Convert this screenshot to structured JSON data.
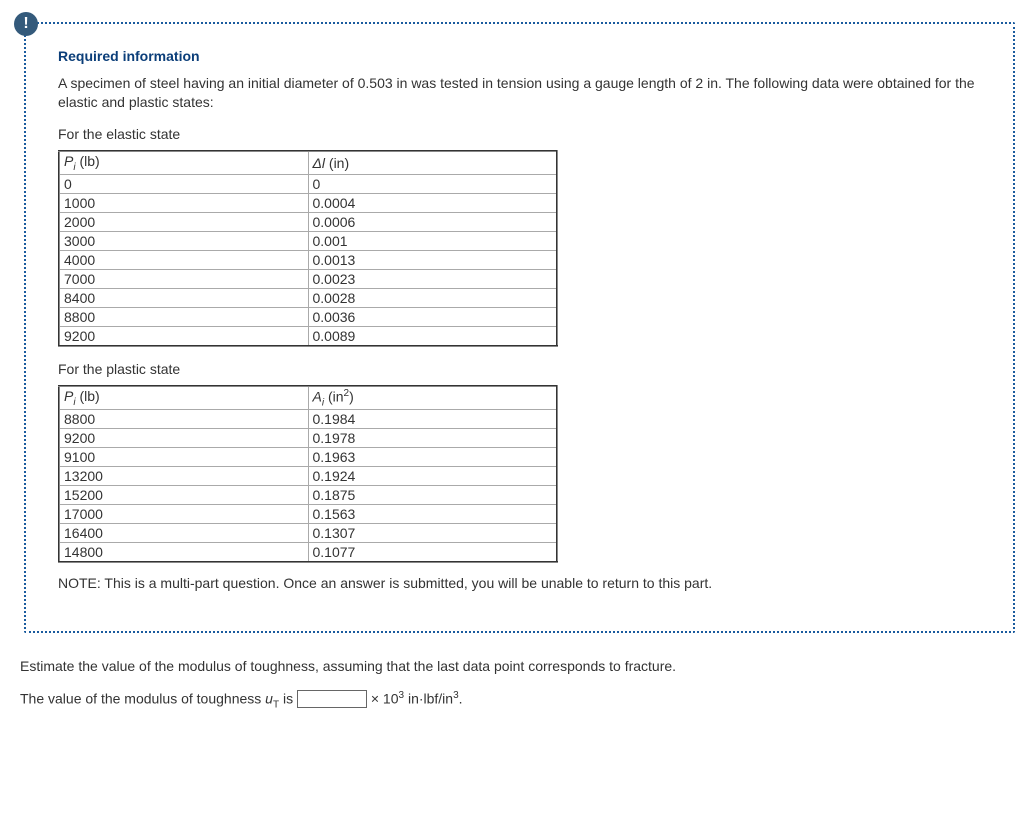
{
  "info_icon_glyph": "!",
  "req_title": "Required information",
  "intro": "A specimen of steel having an initial diameter of 0.503 in was tested in tension using a gauge length of 2 in. The following data were obtained for the elastic and plastic states:",
  "elastic_label": "For the elastic state",
  "elastic_headers": {
    "p": "P",
    "p_sub": "i",
    "p_unit": " (lb)",
    "d": "Δl",
    "d_unit": " (in)"
  },
  "elastic_rows": [
    {
      "p": "0",
      "d": "0"
    },
    {
      "p": "1000",
      "d": "0.0004"
    },
    {
      "p": "2000",
      "d": "0.0006"
    },
    {
      "p": "3000",
      "d": "0.001"
    },
    {
      "p": "4000",
      "d": "0.0013"
    },
    {
      "p": "7000",
      "d": "0.0023"
    },
    {
      "p": "8400",
      "d": "0.0028"
    },
    {
      "p": "8800",
      "d": "0.0036"
    },
    {
      "p": "9200",
      "d": "0.0089"
    }
  ],
  "plastic_label": "For the plastic state",
  "plastic_headers": {
    "p": "P",
    "p_sub": "i",
    "p_unit": " (lb)",
    "a": "A",
    "a_sub": "i",
    "a_unit": " (in",
    "a_sup": "2",
    "a_close": ")"
  },
  "plastic_rows": [
    {
      "p": "8800",
      "a": "0.1984"
    },
    {
      "p": "9200",
      "a": "0.1978"
    },
    {
      "p": "9100",
      "a": "0.1963"
    },
    {
      "p": "13200",
      "a": "0.1924"
    },
    {
      "p": "15200",
      "a": "0.1875"
    },
    {
      "p": "17000",
      "a": "0.1563"
    },
    {
      "p": "16400",
      "a": "0.1307"
    },
    {
      "p": "14800",
      "a": "0.1077"
    }
  ],
  "note": "NOTE: This is a multi-part question. Once an answer is submitted, you will be unable to return to this part.",
  "question": "Estimate the value of the modulus of toughness, assuming that the last data point corresponds to fracture.",
  "answer_prefix": "The value of the modulus of toughness ",
  "answer_symbol": "u",
  "answer_symbol_sub": "T",
  "answer_mid": " is ",
  "answer_suffix_mult": " × 10",
  "answer_suffix_exp": "3",
  "answer_suffix_unit": " in·lbf/in",
  "answer_suffix_unit_exp": "3",
  "answer_suffix_end": "."
}
